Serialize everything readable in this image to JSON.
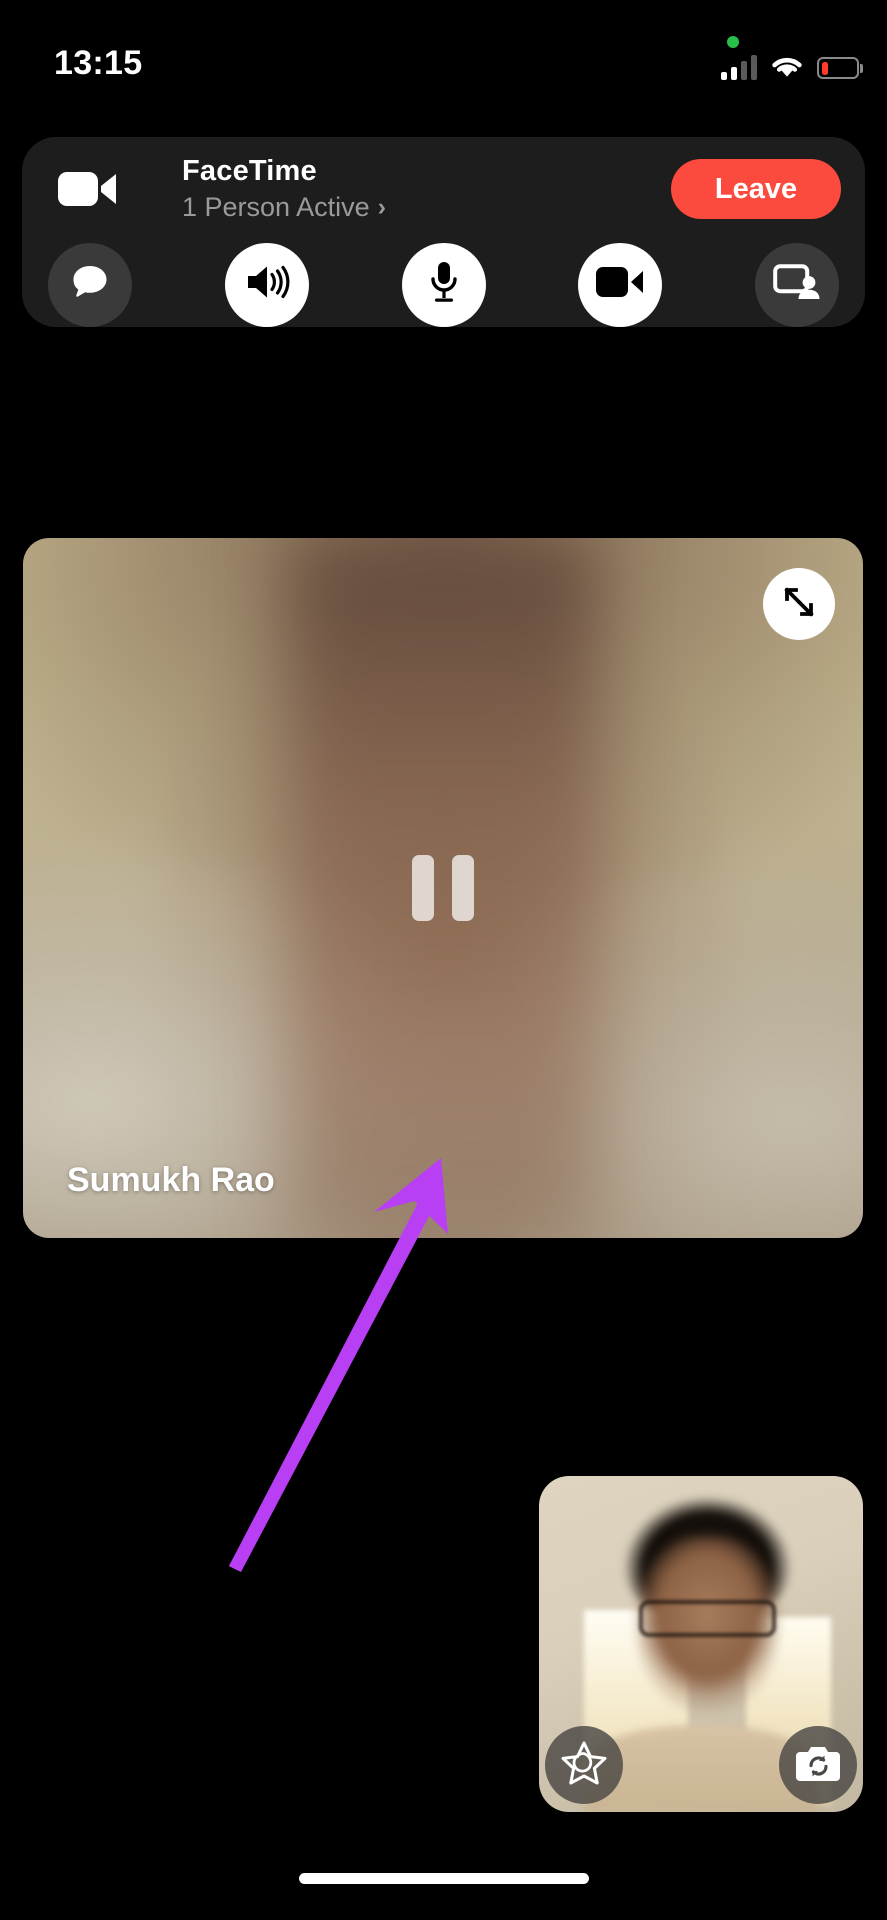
{
  "status_bar": {
    "time": "13:15",
    "camera_indicator": "green-dot",
    "cellular_icon": "cellular-bars-icon",
    "cellular_bars_filled": 2,
    "cellular_bars_total": 4,
    "wifi_icon": "wifi-icon",
    "battery_icon": "battery-low-icon",
    "battery_level_percent": 20,
    "battery_color": "#FF3B30",
    "camera_dot_color": "#29C04A"
  },
  "call_banner": {
    "app_icon": "video-camera-icon",
    "title": "FaceTime",
    "subtitle": "1 Person Active",
    "subtitle_chevron": "›",
    "leave_label": "Leave",
    "leave_color": "#FC4B3E",
    "background_color": "#1D1D1D"
  },
  "controls": [
    {
      "name": "messages-button",
      "icon": "chat-bubble-icon",
      "state": "inactive"
    },
    {
      "name": "speaker-button",
      "icon": "speaker-wave-icon",
      "state": "active"
    },
    {
      "name": "microphone-button",
      "icon": "microphone-icon",
      "state": "active"
    },
    {
      "name": "video-button",
      "icon": "video-camera-icon",
      "state": "active"
    },
    {
      "name": "share-screen-button",
      "icon": "share-screen-icon",
      "state": "inactive"
    }
  ],
  "main_video": {
    "participant_name": "Sumukh Rao",
    "expand_icon": "expand-diagonal-arrows-icon",
    "paused_icon": "pause-icon",
    "state": "paused"
  },
  "self_view": {
    "effects_icon": "effects-star-icon",
    "flip_camera_icon": "camera-flip-icon"
  },
  "annotation": {
    "arrow_icon": "arrow-up-right-icon",
    "color": "#B93FF5",
    "points_to": "pause-icon"
  },
  "system": {
    "home_indicator": "home-indicator-bar"
  }
}
